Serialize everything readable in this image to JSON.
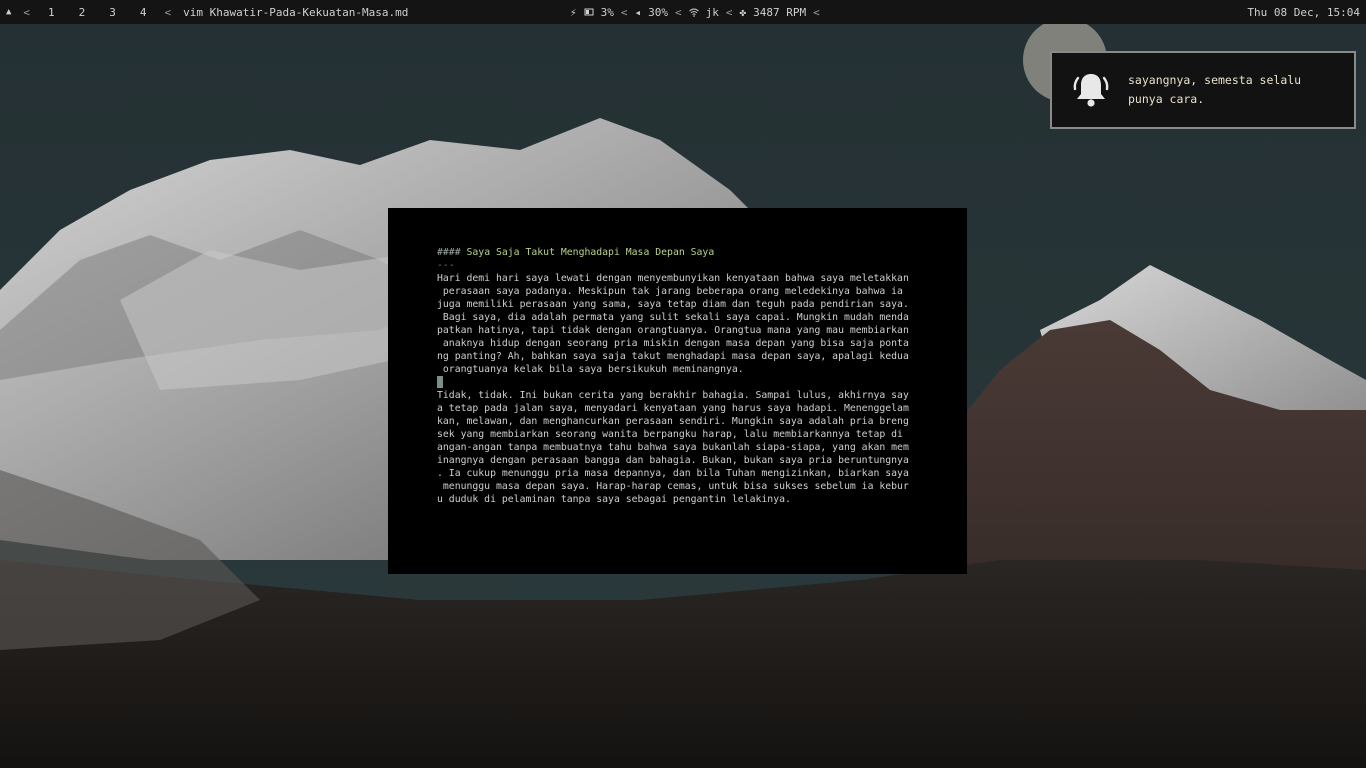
{
  "topbar": {
    "workspaces": [
      "1",
      "2",
      "3",
      "4"
    ],
    "window_title": "vim Khawatir-Pada-Kekuatan-Masa.md",
    "brightness": "3%",
    "volume": "30%",
    "wifi_ssid": "jk",
    "fan_speed": "3487 RPM",
    "datetime": "Thu 08 Dec, 15:04",
    "separator": "<"
  },
  "notification": {
    "line1": "sayangnya, semesta selalu",
    "line2": "punya cara.",
    "icon": "bell-icon"
  },
  "editor": {
    "heading_marker": "####",
    "heading_text": "Saya Saja Takut Menghadapi Masa Depan Saya",
    "rule": "---",
    "paragraph1": [
      "Hari demi hari saya lewati dengan menyembunyikan kenyataan bahwa saya meletakkan",
      " perasaan saya padanya. Meskipun tak jarang beberapa orang meledekinya bahwa ia",
      "juga memiliki perasaan yang sama, saya tetap diam dan teguh pada pendirian saya.",
      " Bagi saya, dia adalah permata yang sulit sekali saya capai. Mungkin mudah menda",
      "patkan hatinya, tapi tidak dengan orangtuanya. Orangtua mana yang mau membiarkan",
      " anaknya hidup dengan seorang pria miskin dengan masa depan yang bisa saja ponta",
      "ng panting? Ah, bahkan saya saja takut menghadapi masa depan saya, apalagi kedua",
      " orangtuanya kelak bila saya bersikukuh meminangnya."
    ],
    "paragraph2": [
      "Tidak, tidak. Ini bukan cerita yang berakhir bahagia. Sampai lulus, akhirnya say",
      "a tetap pada jalan saya, menyadari kenyataan yang harus saya hadapi. Menenggelam",
      "kan, melawan, dan menghancurkan perasaan sendiri. Mungkin saya adalah pria breng",
      "sek yang membiarkan seorang wanita berpangku harap, lalu membiarkannya tetap di",
      "angan-angan tanpa membuatnya tahu bahwa saya bukanlah siapa-siapa, yang akan mem",
      "inangnya dengan perasaan bangga dan bahagia. Bukan, bukan saya pria beruntungnya",
      ". Ia cukup menunggu pria masa depannya, dan bila Tuhan mengizinkan, biarkan saya",
      " menunggu masa depan saya. Harap-harap cemas, untuk bisa sukses sebelum ia kebur",
      "u duduk di pelaminan tanpa saya sebagai pengantin lelakinya."
    ]
  },
  "colors": {
    "bar_bg": "#141414",
    "terminal_bg": "#000000",
    "heading": "#b9d28a",
    "text": "#cfcfcf"
  }
}
